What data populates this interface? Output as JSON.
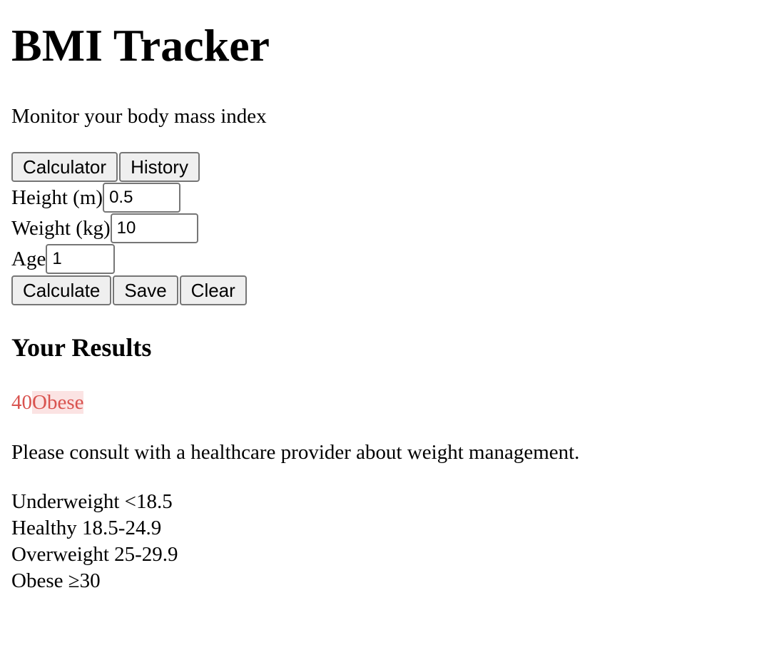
{
  "header": {
    "title": "BMI Tracker",
    "subtitle": "Monitor your body mass index"
  },
  "tabs": [
    {
      "label": "Calculator"
    },
    {
      "label": "History"
    }
  ],
  "form": {
    "height": {
      "label": "Height (m)",
      "value": "0.5"
    },
    "weight": {
      "label": "Weight (kg)",
      "value": "10"
    },
    "age": {
      "label": "Age",
      "value": "1"
    }
  },
  "actions": {
    "calculate_label": "Calculate",
    "save_label": "Save",
    "clear_label": "Clear"
  },
  "results": {
    "title": "Your Results",
    "bmi": "40",
    "category": "Obese",
    "advice": "Please consult with a healthcare provider about weight management.",
    "category_color": "#d9534f",
    "category_bg": "#fbe3e3"
  },
  "legend": [
    {
      "text": "Underweight <18.5"
    },
    {
      "text": "Healthy 18.5-24.9"
    },
    {
      "text": "Overweight 25-29.9"
    },
    {
      "text": "Obese ≥30"
    }
  ]
}
